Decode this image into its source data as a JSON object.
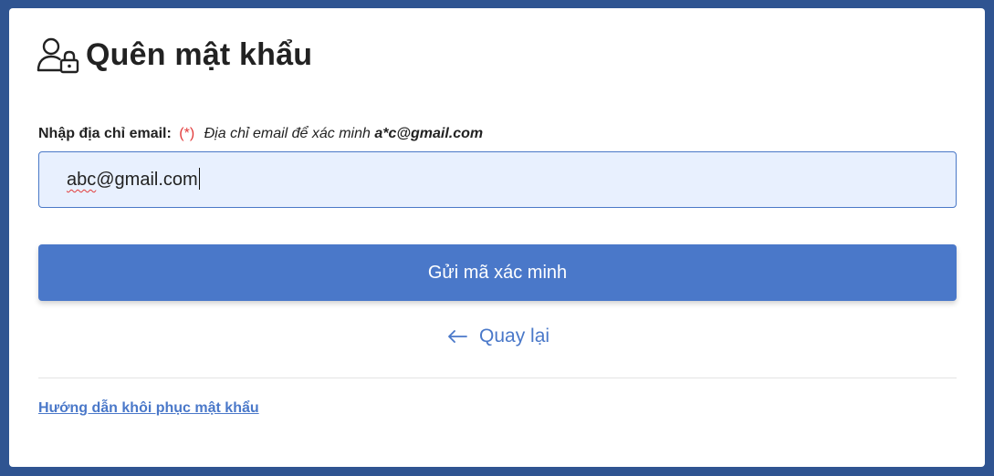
{
  "page": {
    "title": "Quên mật khẩu",
    "title_icon": "user-lock-icon"
  },
  "form": {
    "label": "Nhập địa chỉ email:",
    "required_mark": "(*)",
    "hint": "Địa chỉ email để xác minh",
    "masked_email": "a*c@gmail.com",
    "email_value_misspelled": "abc",
    "email_value_rest": "@gmail.com",
    "submit_label": "Gửi mã xác minh"
  },
  "nav": {
    "back_icon": "arrow-left-icon",
    "back_label": "Quay lại",
    "guide_link": "Hướng dẫn khôi phục mật khẩu"
  },
  "colors": {
    "background": "#2f5491",
    "primary": "#4a78c9",
    "required": "#e23b3b",
    "input_background": "#e8f0fe"
  }
}
